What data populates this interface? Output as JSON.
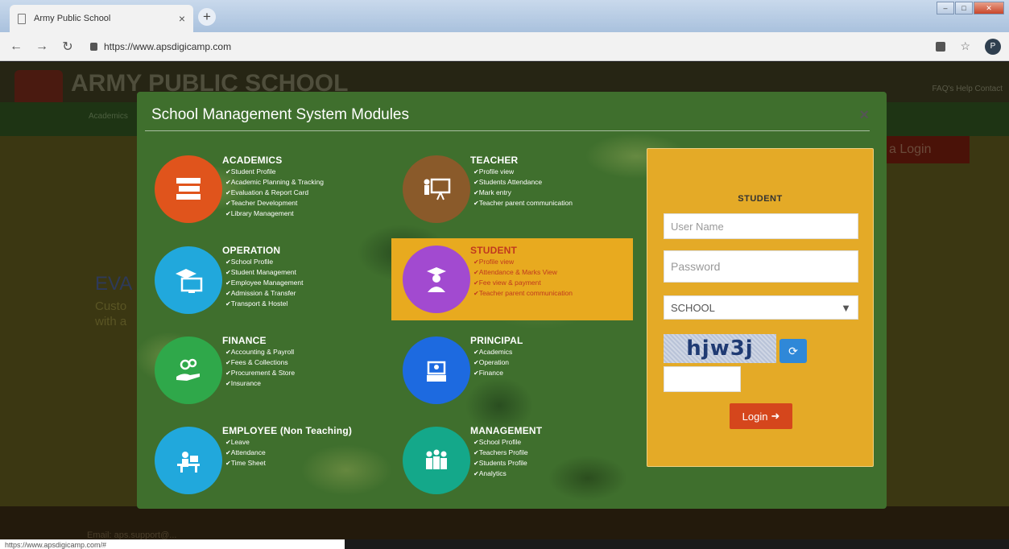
{
  "browser": {
    "tab_title": "Army Public School",
    "tab_close": "×",
    "new_tab": "+",
    "url": "https://www.apsdigicamp.com",
    "status_url": "https://www.apsdigicamp.com/#",
    "profile_initial": "P"
  },
  "background_page": {
    "site_name": "ARMY PUBLIC SCHOOL",
    "top_links": "FAQ's   Help   Contact",
    "menu_item": "Academics",
    "hero_title": "EVA",
    "hero_sub_1": "Custo",
    "hero_sub_2": "with a",
    "login_button": "a Login",
    "footer_text": "Email: aps.support@..."
  },
  "modal": {
    "title": "School Management System Modules",
    "close": "×",
    "modules": [
      {
        "title": "ACADEMICS",
        "icon": "books-icon",
        "color": "#e0541c",
        "items": [
          "Student Profile",
          "Academic Planning & Tracking",
          "Evaluation & Report Card",
          "Teacher Development",
          "Library Management"
        ]
      },
      {
        "title": "TEACHER",
        "icon": "teacher-board-icon",
        "color": "#8a5a2a",
        "items": [
          "Profile view",
          "Students Attendance",
          "Mark entry",
          "Teacher parent communication"
        ]
      },
      {
        "title": "OPERATION",
        "icon": "graduation-monitor-icon",
        "color": "#21a8dc",
        "items": [
          "School Profile",
          "Student Management",
          "Employee Management",
          "Admission & Transfer",
          "Transport & Hostel"
        ]
      },
      {
        "title": "STUDENT",
        "icon": "student-icon",
        "color": "#a24ad0",
        "items": [
          "Profile view",
          "Attendance & Marks View",
          "Fee view & payment",
          "Teacher parent communication"
        ]
      },
      {
        "title": "FINANCE",
        "icon": "coins-hand-icon",
        "color": "#2fa84a",
        "items": [
          "Accounting & Payroll",
          "Fees & Collections",
          "Procurement & Store",
          "Insurance"
        ]
      },
      {
        "title": "PRINCIPAL",
        "icon": "principal-icon",
        "color": "#1d6ae0",
        "items": [
          "Academics",
          "Operation",
          "Finance"
        ]
      },
      {
        "title": "EMPLOYEE (Non Teaching)",
        "icon": "employee-desk-icon",
        "color": "#21a8dc",
        "items": [
          "Leave",
          "Attendance",
          "Time Sheet"
        ]
      },
      {
        "title": "MANAGEMENT",
        "icon": "team-icon",
        "color": "#14a88a",
        "items": [
          "School Profile",
          "Teachers Profile",
          "Students Profile",
          "Analytics"
        ]
      }
    ]
  },
  "login": {
    "title": "STUDENT",
    "username_placeholder": "User Name",
    "password_placeholder": "Password",
    "school_select": "SCHOOL",
    "captcha_text": "hjw3j",
    "login_button": "Login"
  }
}
